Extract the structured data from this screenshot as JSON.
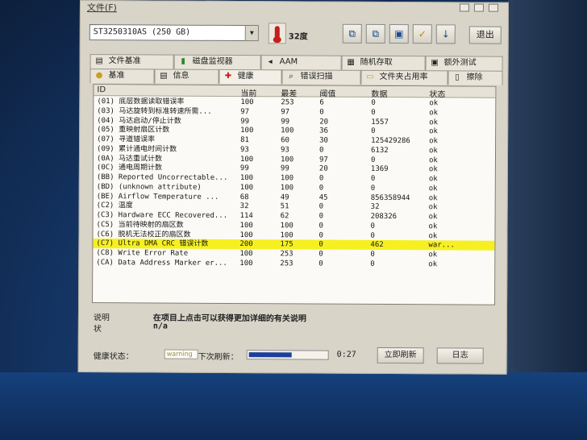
{
  "menubar": {
    "label": "文件(F)"
  },
  "toolbar": {
    "drive": "ST3250310AS (250 GB)",
    "temperature": "32度",
    "exit_label": "退出",
    "icons": [
      "copy-icon",
      "paste-icon",
      "save-icon",
      "options-icon",
      "down-arrow-icon"
    ]
  },
  "tabs_row1": [
    {
      "label": "文件基准",
      "icon": "file-benchmark-icon"
    },
    {
      "label": "磁盘监视器",
      "icon": "disk-monitor-icon"
    },
    {
      "label": "AAM",
      "icon": "aam-icon"
    },
    {
      "label": "随机存取",
      "icon": "random-access-icon"
    },
    {
      "label": "额外测试",
      "icon": "extra-test-icon"
    }
  ],
  "tabs_row2": [
    {
      "label": "基准",
      "icon": "benchmark-icon"
    },
    {
      "label": "信息",
      "icon": "info-icon"
    },
    {
      "label": "健康",
      "icon": "health-icon"
    },
    {
      "label": "错误扫描",
      "icon": "error-scan-icon"
    },
    {
      "label": "文件夹占用率",
      "icon": "folder-usage-icon"
    },
    {
      "label": "擦除",
      "icon": "erase-icon"
    }
  ],
  "smart_table": {
    "headers": {
      "id": "ID",
      "current": "当前",
      "worst": "最差",
      "threshold": "阈值",
      "raw": "数据",
      "status": "状态"
    },
    "rows": [
      {
        "id": "(01) 底层数据读取错误率",
        "cur": "100",
        "worst": "253",
        "thr": "6",
        "raw": "0",
        "st": "ok",
        "hl": false
      },
      {
        "id": "(03) 马达旋转到标准转速所需...",
        "cur": "97",
        "worst": "97",
        "thr": "0",
        "raw": "0",
        "st": "ok",
        "hl": false
      },
      {
        "id": "(04) 马达启动/停止计数",
        "cur": "99",
        "worst": "99",
        "thr": "20",
        "raw": "1557",
        "st": "ok",
        "hl": false
      },
      {
        "id": "(05) 重映射扇区计数",
        "cur": "100",
        "worst": "100",
        "thr": "36",
        "raw": "0",
        "st": "ok",
        "hl": false
      },
      {
        "id": "(07) 寻道错误率",
        "cur": "81",
        "worst": "60",
        "thr": "30",
        "raw": "125429286",
        "st": "ok",
        "hl": false
      },
      {
        "id": "(09) 累计通电时间计数",
        "cur": "93",
        "worst": "93",
        "thr": "0",
        "raw": "6132",
        "st": "ok",
        "hl": false
      },
      {
        "id": "(0A) 马达重试计数",
        "cur": "100",
        "worst": "100",
        "thr": "97",
        "raw": "0",
        "st": "ok",
        "hl": false
      },
      {
        "id": "(0C) 通电周期计数",
        "cur": "99",
        "worst": "99",
        "thr": "20",
        "raw": "1369",
        "st": "ok",
        "hl": false
      },
      {
        "id": "(BB) Reported Uncorrectable...",
        "cur": "100",
        "worst": "100",
        "thr": "0",
        "raw": "0",
        "st": "ok",
        "hl": false
      },
      {
        "id": "(BD) (unknown attribute)",
        "cur": "100",
        "worst": "100",
        "thr": "0",
        "raw": "0",
        "st": "ok",
        "hl": false
      },
      {
        "id": "(BE) Airflow Temperature ...",
        "cur": "68",
        "worst": "49",
        "thr": "45",
        "raw": "856358944",
        "st": "ok",
        "hl": false
      },
      {
        "id": "(C2) 温度",
        "cur": "32",
        "worst": "51",
        "thr": "0",
        "raw": "32",
        "st": "ok",
        "hl": false
      },
      {
        "id": "(C3) Hardware ECC Recovered...",
        "cur": "114",
        "worst": "62",
        "thr": "0",
        "raw": "208326",
        "st": "ok",
        "hl": false
      },
      {
        "id": "(C5) 当前待映射的扇区数",
        "cur": "100",
        "worst": "100",
        "thr": "0",
        "raw": "0",
        "st": "ok",
        "hl": false
      },
      {
        "id": "(C6) 脱机无法校正的扇区数",
        "cur": "100",
        "worst": "100",
        "thr": "0",
        "raw": "0",
        "st": "ok",
        "hl": false
      },
      {
        "id": "(C7) Ultra DMA CRC 错误计数",
        "cur": "200",
        "worst": "175",
        "thr": "0",
        "raw": "462",
        "st": "war...",
        "hl": true
      },
      {
        "id": "(C8) Write Error Rate",
        "cur": "100",
        "worst": "253",
        "thr": "0",
        "raw": "0",
        "st": "ok",
        "hl": false
      },
      {
        "id": "(CA) Data Address Marker er...",
        "cur": "100",
        "worst": "253",
        "thr": "0",
        "raw": "0",
        "st": "ok",
        "hl": false
      }
    ]
  },
  "info": {
    "desc_label": "说明",
    "desc_text": "在项目上点击可以获得更加详细的有关说明",
    "state_label": "状",
    "state_value": "n/a"
  },
  "status_bar": {
    "health_label": "健康状态：",
    "health_value": "warning",
    "refresh_label": "下次刷新：",
    "refresh_progress": 0.55,
    "countdown": "0:27",
    "refresh_now": "立即刷新",
    "log": "日志"
  }
}
